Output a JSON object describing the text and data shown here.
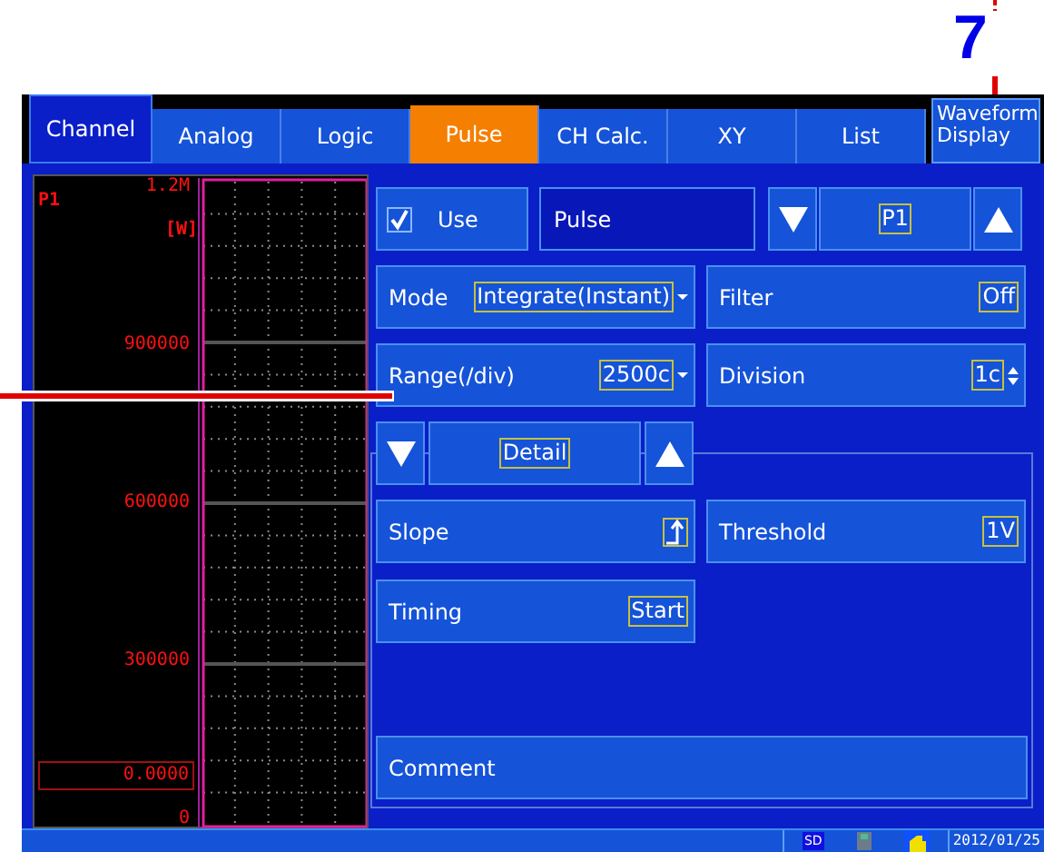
{
  "callout": {
    "label": "7"
  },
  "header_tab": {
    "label": "Channel"
  },
  "tabs": [
    {
      "label": "Analog",
      "selected": false
    },
    {
      "label": "Logic",
      "selected": false
    },
    {
      "label": "Pulse",
      "selected": true
    },
    {
      "label": "CH Calc.",
      "selected": false
    },
    {
      "label": "XY",
      "selected": false
    },
    {
      "label": "List",
      "selected": false
    }
  ],
  "display_button": {
    "label": "Waveform Display"
  },
  "waveform": {
    "channel": "P1",
    "unit": "[W]",
    "axis_labels": [
      "1.2M",
      "900000",
      "600000",
      "300000",
      "0"
    ],
    "cursor_value": "0.0000"
  },
  "use": {
    "label": "Use",
    "checked": true
  },
  "channel_name": "Pulse",
  "channel_selector": {
    "value": "P1"
  },
  "settings": [
    {
      "label": "Mode",
      "value": "Integrate(Instant)",
      "kind": "dropdown"
    },
    {
      "label": "Filter",
      "value": "Off",
      "kind": "plain"
    },
    {
      "label": "Range(/div)",
      "value": "2500c",
      "kind": "dropdown"
    },
    {
      "label": "Division",
      "value": "1c",
      "kind": "spinner"
    }
  ],
  "detail_selector": {
    "value": "Detail"
  },
  "detail_settings": [
    {
      "label": "Slope",
      "kind": "rising_edge"
    },
    {
      "label": "Threshold",
      "value": "1V",
      "kind": "plain"
    },
    {
      "label": "Timing",
      "value": "Start",
      "kind": "plain"
    }
  ],
  "comment": {
    "label": "Comment"
  },
  "status_bar": {
    "date": "2012/01/25",
    "storage": "SD"
  }
}
